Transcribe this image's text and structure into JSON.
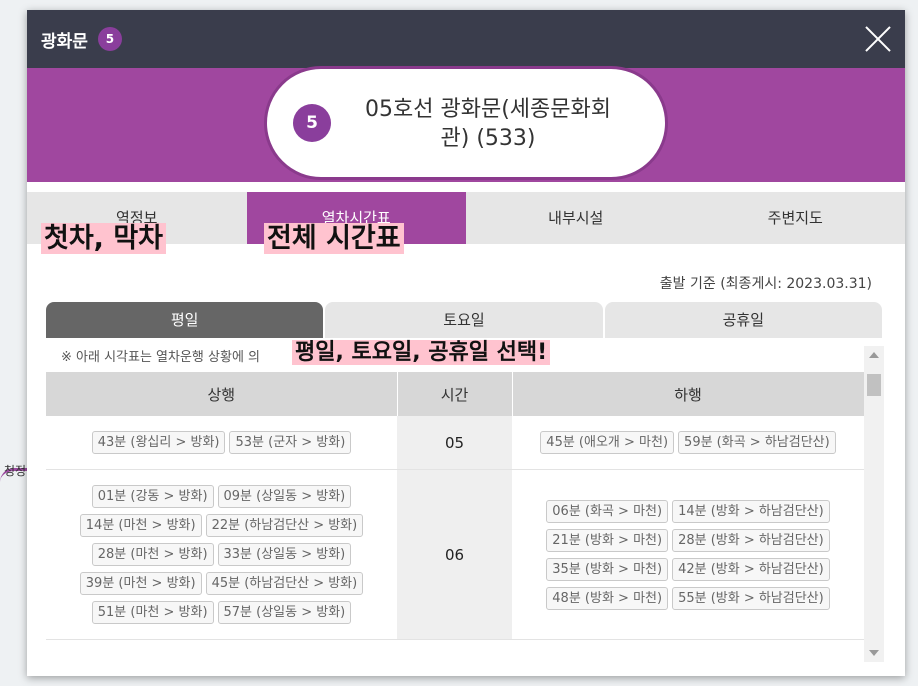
{
  "background": {
    "map_label": "청정"
  },
  "modal": {
    "title": "광화문",
    "line_number": "5",
    "line_color": "#a0479f",
    "station_full_name": "05호선 광화문(세종문화회관) (533)"
  },
  "tabs": [
    {
      "label": "역정보",
      "active": false
    },
    {
      "label": "열차시간표",
      "active": true
    },
    {
      "label": "내부시설",
      "active": false
    },
    {
      "label": "주변지도",
      "active": false
    }
  ],
  "annotations": {
    "first_last": "첫차, 막차",
    "full_timetable": "전체 시간표",
    "select_day": "평일, 토요일, 공휴일 선택!"
  },
  "basis_text": "출발 기준 (최종게시: 2023.03.31)",
  "day_tabs": [
    {
      "label": "평일",
      "active": true
    },
    {
      "label": "토요일",
      "active": false
    },
    {
      "label": "공휴일",
      "active": false
    }
  ],
  "notice": "※ 아래 시각표는 열차운행 상황에 의",
  "timetable": {
    "headers": {
      "up": "상행",
      "hour": "시간",
      "down": "하행"
    },
    "rows": [
      {
        "hour": "05",
        "up": [
          "43분 (왕십리 > 방화)",
          "53분 (군자 > 방화)"
        ],
        "down": [
          "45분 (애오개 > 마천)",
          "59분 (화곡 > 하남검단산)"
        ]
      },
      {
        "hour": "06",
        "up": [
          "01분 (강동 > 방화)",
          "09분 (상일동 > 방화)",
          "14분 (마천 > 방화)",
          "22분 (하남검단산 > 방화)",
          "28분 (마천 > 방화)",
          "33분 (상일동 > 방화)",
          "39분 (마천 > 방화)",
          "45분 (하남검단산 > 방화)",
          "51분 (마천 > 방화)",
          "57분 (상일동 > 방화)"
        ],
        "down": [
          "06분 (화곡 > 마천)",
          "14분 (방화 > 하남검단산)",
          "21분 (방화 > 마천)",
          "28분 (방화 > 하남검단산)",
          "35분 (방화 > 마천)",
          "42분 (방화 > 하남검단산)",
          "48분 (방화 > 마천)",
          "55분 (방화 > 하남검단산)"
        ]
      }
    ]
  }
}
